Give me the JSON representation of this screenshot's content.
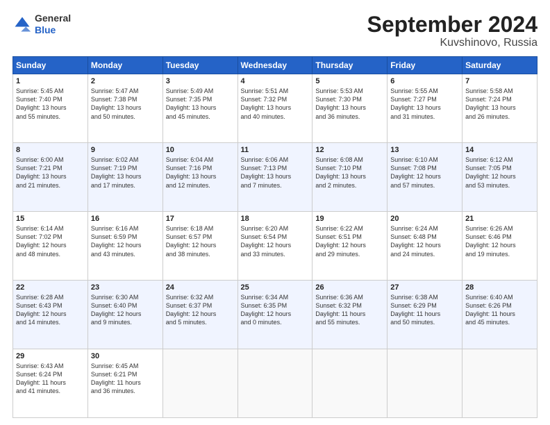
{
  "header": {
    "logo": {
      "general": "General",
      "blue": "Blue"
    },
    "month": "September 2024",
    "location": "Kuvshinovo, Russia"
  },
  "weekdays": [
    "Sunday",
    "Monday",
    "Tuesday",
    "Wednesday",
    "Thursday",
    "Friday",
    "Saturday"
  ],
  "weeks": [
    [
      {
        "day": "1",
        "lines": [
          "Sunrise: 5:45 AM",
          "Sunset: 7:40 PM",
          "Daylight: 13 hours",
          "and 55 minutes."
        ]
      },
      {
        "day": "2",
        "lines": [
          "Sunrise: 5:47 AM",
          "Sunset: 7:38 PM",
          "Daylight: 13 hours",
          "and 50 minutes."
        ]
      },
      {
        "day": "3",
        "lines": [
          "Sunrise: 5:49 AM",
          "Sunset: 7:35 PM",
          "Daylight: 13 hours",
          "and 45 minutes."
        ]
      },
      {
        "day": "4",
        "lines": [
          "Sunrise: 5:51 AM",
          "Sunset: 7:32 PM",
          "Daylight: 13 hours",
          "and 40 minutes."
        ]
      },
      {
        "day": "5",
        "lines": [
          "Sunrise: 5:53 AM",
          "Sunset: 7:30 PM",
          "Daylight: 13 hours",
          "and 36 minutes."
        ]
      },
      {
        "day": "6",
        "lines": [
          "Sunrise: 5:55 AM",
          "Sunset: 7:27 PM",
          "Daylight: 13 hours",
          "and 31 minutes."
        ]
      },
      {
        "day": "7",
        "lines": [
          "Sunrise: 5:58 AM",
          "Sunset: 7:24 PM",
          "Daylight: 13 hours",
          "and 26 minutes."
        ]
      }
    ],
    [
      {
        "day": "8",
        "lines": [
          "Sunrise: 6:00 AM",
          "Sunset: 7:21 PM",
          "Daylight: 13 hours",
          "and 21 minutes."
        ]
      },
      {
        "day": "9",
        "lines": [
          "Sunrise: 6:02 AM",
          "Sunset: 7:19 PM",
          "Daylight: 13 hours",
          "and 17 minutes."
        ]
      },
      {
        "day": "10",
        "lines": [
          "Sunrise: 6:04 AM",
          "Sunset: 7:16 PM",
          "Daylight: 13 hours",
          "and 12 minutes."
        ]
      },
      {
        "day": "11",
        "lines": [
          "Sunrise: 6:06 AM",
          "Sunset: 7:13 PM",
          "Daylight: 13 hours",
          "and 7 minutes."
        ]
      },
      {
        "day": "12",
        "lines": [
          "Sunrise: 6:08 AM",
          "Sunset: 7:10 PM",
          "Daylight: 13 hours",
          "and 2 minutes."
        ]
      },
      {
        "day": "13",
        "lines": [
          "Sunrise: 6:10 AM",
          "Sunset: 7:08 PM",
          "Daylight: 12 hours",
          "and 57 minutes."
        ]
      },
      {
        "day": "14",
        "lines": [
          "Sunrise: 6:12 AM",
          "Sunset: 7:05 PM",
          "Daylight: 12 hours",
          "and 53 minutes."
        ]
      }
    ],
    [
      {
        "day": "15",
        "lines": [
          "Sunrise: 6:14 AM",
          "Sunset: 7:02 PM",
          "Daylight: 12 hours",
          "and 48 minutes."
        ]
      },
      {
        "day": "16",
        "lines": [
          "Sunrise: 6:16 AM",
          "Sunset: 6:59 PM",
          "Daylight: 12 hours",
          "and 43 minutes."
        ]
      },
      {
        "day": "17",
        "lines": [
          "Sunrise: 6:18 AM",
          "Sunset: 6:57 PM",
          "Daylight: 12 hours",
          "and 38 minutes."
        ]
      },
      {
        "day": "18",
        "lines": [
          "Sunrise: 6:20 AM",
          "Sunset: 6:54 PM",
          "Daylight: 12 hours",
          "and 33 minutes."
        ]
      },
      {
        "day": "19",
        "lines": [
          "Sunrise: 6:22 AM",
          "Sunset: 6:51 PM",
          "Daylight: 12 hours",
          "and 29 minutes."
        ]
      },
      {
        "day": "20",
        "lines": [
          "Sunrise: 6:24 AM",
          "Sunset: 6:48 PM",
          "Daylight: 12 hours",
          "and 24 minutes."
        ]
      },
      {
        "day": "21",
        "lines": [
          "Sunrise: 6:26 AM",
          "Sunset: 6:46 PM",
          "Daylight: 12 hours",
          "and 19 minutes."
        ]
      }
    ],
    [
      {
        "day": "22",
        "lines": [
          "Sunrise: 6:28 AM",
          "Sunset: 6:43 PM",
          "Daylight: 12 hours",
          "and 14 minutes."
        ]
      },
      {
        "day": "23",
        "lines": [
          "Sunrise: 6:30 AM",
          "Sunset: 6:40 PM",
          "Daylight: 12 hours",
          "and 9 minutes."
        ]
      },
      {
        "day": "24",
        "lines": [
          "Sunrise: 6:32 AM",
          "Sunset: 6:37 PM",
          "Daylight: 12 hours",
          "and 5 minutes."
        ]
      },
      {
        "day": "25",
        "lines": [
          "Sunrise: 6:34 AM",
          "Sunset: 6:35 PM",
          "Daylight: 12 hours",
          "and 0 minutes."
        ]
      },
      {
        "day": "26",
        "lines": [
          "Sunrise: 6:36 AM",
          "Sunset: 6:32 PM",
          "Daylight: 11 hours",
          "and 55 minutes."
        ]
      },
      {
        "day": "27",
        "lines": [
          "Sunrise: 6:38 AM",
          "Sunset: 6:29 PM",
          "Daylight: 11 hours",
          "and 50 minutes."
        ]
      },
      {
        "day": "28",
        "lines": [
          "Sunrise: 6:40 AM",
          "Sunset: 6:26 PM",
          "Daylight: 11 hours",
          "and 45 minutes."
        ]
      }
    ],
    [
      {
        "day": "29",
        "lines": [
          "Sunrise: 6:43 AM",
          "Sunset: 6:24 PM",
          "Daylight: 11 hours",
          "and 41 minutes."
        ]
      },
      {
        "day": "30",
        "lines": [
          "Sunrise: 6:45 AM",
          "Sunset: 6:21 PM",
          "Daylight: 11 hours",
          "and 36 minutes."
        ]
      },
      {
        "day": "",
        "lines": []
      },
      {
        "day": "",
        "lines": []
      },
      {
        "day": "",
        "lines": []
      },
      {
        "day": "",
        "lines": []
      },
      {
        "day": "",
        "lines": []
      }
    ]
  ]
}
